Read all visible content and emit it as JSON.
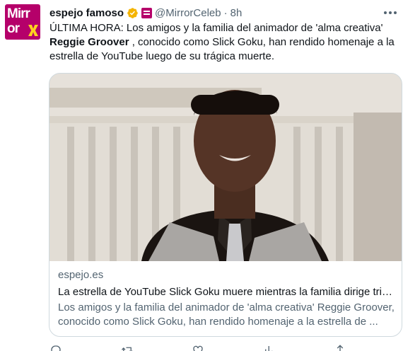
{
  "tweet": {
    "avatar": {
      "line1": "Mirr",
      "line2": "or",
      "brand_color": "#b5006a",
      "accent_color": "#ffd21f"
    },
    "author_name": "espejo famoso",
    "handle": "@MirrorCeleb",
    "separator": "·",
    "time": "8h",
    "text_before": "ÚLTIMA HORA: Los amigos y la familia del animador de 'alma creativa'",
    "text_bold": "Reggie Groover",
    "text_after": " , conocido como Slick Goku, han rendido homenaje a la estrella de YouTube luego de su trágica muerte.",
    "card": {
      "image_icon": "photo-of-man-in-grey-vest",
      "domain": "espejo.es",
      "title": "La estrella de YouTube Slick Goku muere mientras la familia dirige trib...",
      "description": "Los amigos y la familia del animador de 'alma creativa' Reggie Groover, conocido como Slick Goku, han rendido homenaje a la estrella de ..."
    },
    "actions": [
      "reply-icon",
      "retweet-icon",
      "like-icon",
      "views-icon",
      "share-icon"
    ]
  },
  "colors": {
    "text": "#0f1419",
    "secondary": "#536471",
    "border": "#cfd9de",
    "verified": "#f4b400"
  }
}
